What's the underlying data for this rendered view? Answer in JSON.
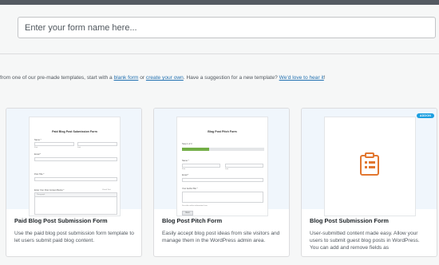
{
  "search": {
    "placeholder": "Enter your form name here..."
  },
  "intro": {
    "prefix": "from one of our pre-made templates, start with a ",
    "link_blank": "blank form",
    "mid1": " or ",
    "link_own": "create your own",
    "mid2": ". Have a suggestion for a new template? ",
    "link_love": "We'd love to hear it",
    "suffix": "!"
  },
  "colors": {
    "link": "#2271b1",
    "accent": "#e27730",
    "badge": "#1d9fe0",
    "progress": "#73ae47"
  },
  "cards": [
    {
      "title": "Paid Blog Post Submission Form",
      "description": "Use the paid blog post submission form template to let users submit paid blog content.",
      "preview": {
        "form_title": "Paid Blog Post Submission Form",
        "name_label": "Name *",
        "first_label": "First",
        "last_label": "Last",
        "email_label": "Email *",
        "posttitle_label": "Post Title *",
        "content_label": "Enter Your Post Content Below *",
        "editor_tabs": "Visual Text",
        "paragraph": "Paragraph"
      }
    },
    {
      "title": "Blog Post Pitch Form",
      "description": "Easily accept blog post ideas from site visitors and manage them in the WordPress admin area.",
      "preview": {
        "form_title": "Blog Post Pitch Form",
        "step": "Step 1 of 3",
        "progress": 0.33,
        "name_label": "Name *",
        "first_label": "First",
        "last_label": "Last",
        "email_label": "Email *",
        "bio_label": "Your Author Bio *",
        "hint": "Describe author information here",
        "next_label": "Next"
      }
    },
    {
      "title": "Blog Post Submission Form",
      "description": "User-submitted content made easy. Allow your users to submit guest blog posts in WordPress. You can add and remove fields as",
      "badge": "ADDON",
      "icon": "document-form-icon"
    }
  ]
}
